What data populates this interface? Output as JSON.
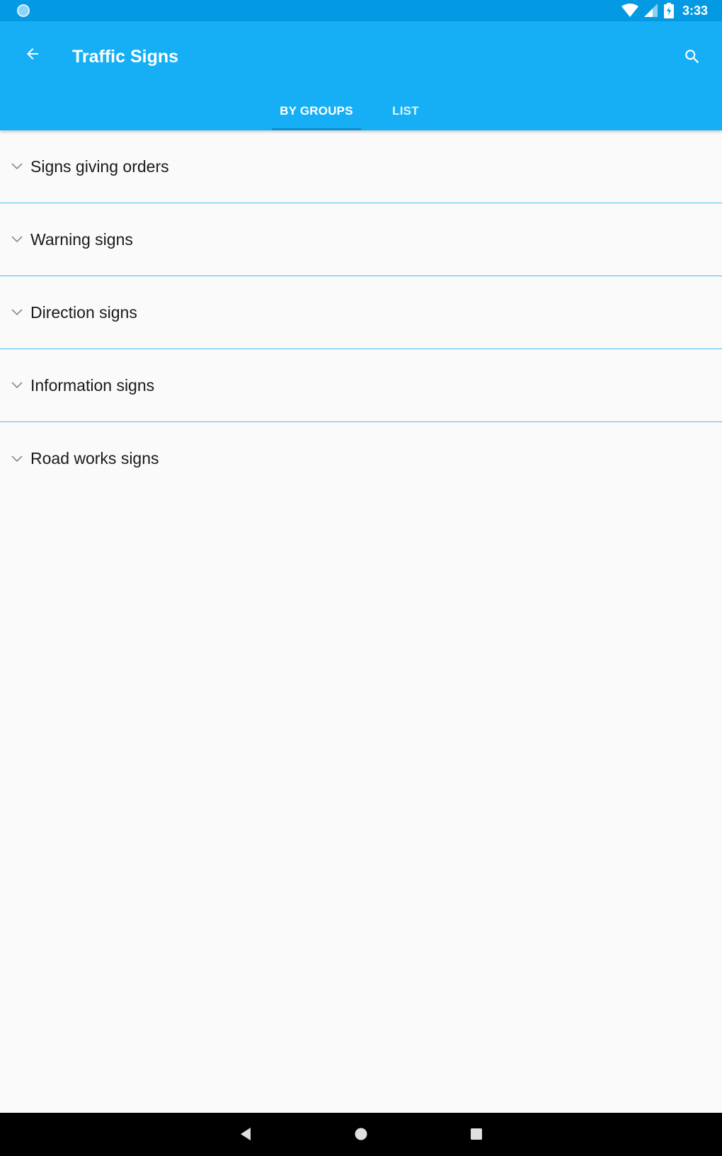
{
  "status_bar": {
    "time": "3:33",
    "icons": [
      "notification-dot-icon",
      "wifi-icon",
      "cellular-signal-icon",
      "battery-charging-icon"
    ]
  },
  "app_bar": {
    "title": "Traffic Signs",
    "back_icon": "arrow-back-icon",
    "search_icon": "search-icon",
    "color": "#16aff5"
  },
  "tabs": [
    {
      "label": "BY GROUPS",
      "selected": true
    },
    {
      "label": "LIST",
      "selected": false
    }
  ],
  "groups": [
    {
      "label": "Signs giving orders",
      "icon": "chevron-down-icon"
    },
    {
      "label": "Warning signs",
      "icon": "chevron-down-icon"
    },
    {
      "label": "Direction signs",
      "icon": "chevron-down-icon"
    },
    {
      "label": "Information signs",
      "icon": "chevron-down-icon"
    },
    {
      "label": "Road works signs",
      "icon": "chevron-down-icon"
    }
  ],
  "nav_bar": {
    "icons": [
      "nav-back-icon",
      "nav-home-icon",
      "nav-recents-icon"
    ]
  }
}
